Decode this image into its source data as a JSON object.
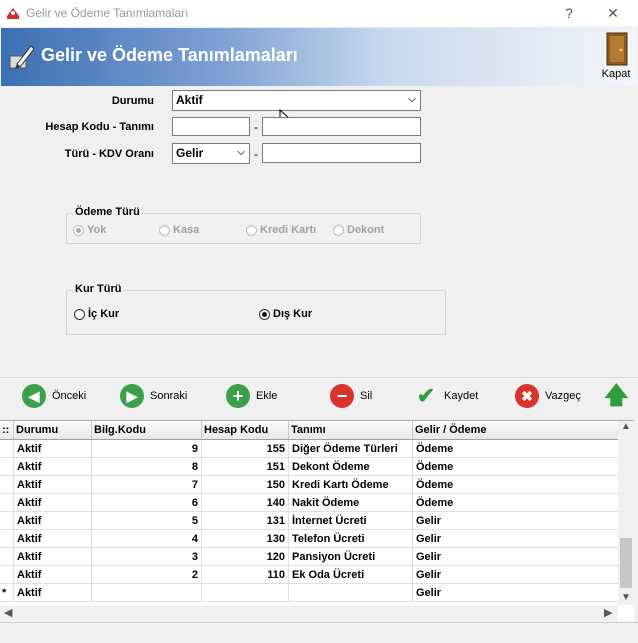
{
  "window": {
    "title": "Gelir ve Ödeme Tanımlamaları",
    "help_label": "?",
    "close_label": "✕"
  },
  "header": {
    "title": "Gelir ve Ödeme Tanımlamaları",
    "close_button_label": "Kapat"
  },
  "form": {
    "durumu_label": "Durumu",
    "durumu_value": "Aktif",
    "hesap_label": "Hesap Kodu - Tanımı",
    "hesap_kodu_value": "",
    "hesap_tanimi_value": "",
    "turu_label": "Türü - KDV Oranı",
    "turu_value": "Gelir",
    "kdv_value": "",
    "dash": "-"
  },
  "odeme_turu": {
    "caption": "Ödeme Türü",
    "options": [
      "Yok",
      "Kasa",
      "Kredi Kartı",
      "Dekont"
    ],
    "selected": "Yok",
    "disabled": true
  },
  "kur_turu": {
    "caption": "Kur Türü",
    "options": [
      "İç Kur",
      "Dış Kur"
    ],
    "selected": "Dış Kur"
  },
  "toolbar": {
    "prev_label": "Önceki",
    "next_label": "Sonraki",
    "add_label": "Ekle",
    "delete_label": "Sil",
    "save_label": "Kaydet",
    "cancel_label": "Vazgeç"
  },
  "grid": {
    "row_indicator_header": "::",
    "columns": [
      "Durumu",
      "Bilg.Kodu",
      "Hesap Kodu",
      "Tanımı",
      "Gelir / Ödeme"
    ],
    "rows": [
      [
        "Aktif",
        "9",
        "155",
        "Diğer Ödeme Türleri",
        "Ödeme"
      ],
      [
        "Aktif",
        "8",
        "151",
        "Dekont Ödeme",
        "Ödeme"
      ],
      [
        "Aktif",
        "7",
        "150",
        "Kredi Kartı Ödeme",
        "Ödeme"
      ],
      [
        "Aktif",
        "6",
        "140",
        "Nakit Ödeme",
        "Ödeme"
      ],
      [
        "Aktif",
        "5",
        "131",
        "İnternet Ücreti",
        "Gelir"
      ],
      [
        "Aktif",
        "4",
        "130",
        "Telefon Ücreti",
        "Gelir"
      ],
      [
        "Aktif",
        "3",
        "120",
        "Pansiyon Ücreti",
        "Gelir"
      ],
      [
        "Aktif",
        "2",
        "110",
        "Ek Oda Ücreti",
        "Gelir"
      ]
    ],
    "new_row": {
      "indicator": "*",
      "values": [
        "Aktif",
        "",
        "",
        "",
        "Gelir"
      ]
    }
  },
  "colors": {
    "banner_blue": "#3b6fb4",
    "prev_next_green": "#3aa14a",
    "add_green": "#3aa14a",
    "delete_red": "#d9342b",
    "cancel_red": "#d9342b",
    "save_check_green": "#2f9e3a"
  },
  "icons": {
    "app": "app-logo-icon",
    "header": "pen-document-icon",
    "kapat": "door-icon",
    "prev": "arrow-left-icon",
    "next": "arrow-right-icon",
    "add": "plus-icon",
    "delete": "minus-icon",
    "save": "checkmark-icon",
    "cancel": "x-icon",
    "up": "arrow-up-icon"
  }
}
